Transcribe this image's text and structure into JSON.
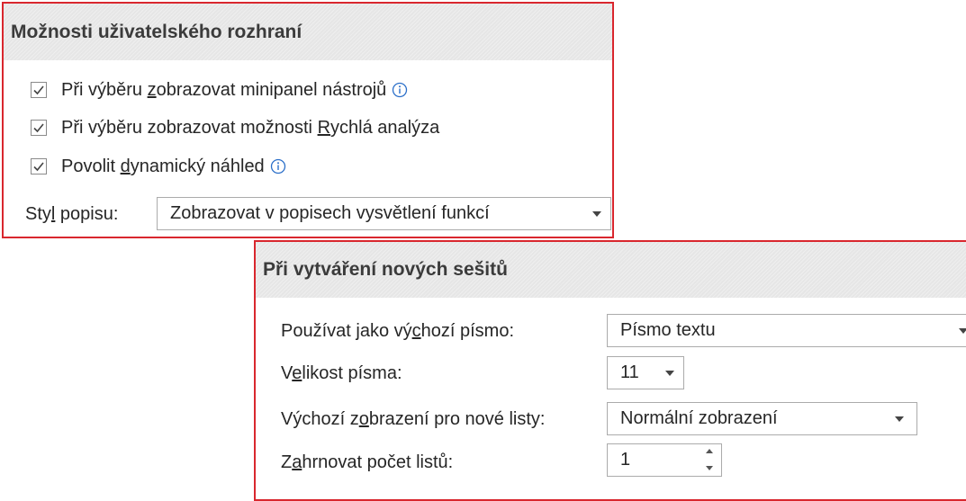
{
  "colors": {
    "highlight_border": "#d9272e",
    "header_bg": "#e6e6e6",
    "field_border": "#ababab"
  },
  "ui_options": {
    "title": "Možnosti uživatelského rozhraní",
    "checkboxes": [
      {
        "checked": true,
        "text_before": "Při výběru ",
        "underlined": "z",
        "text_after": "obrazovat minipanel nástrojů",
        "info_icon": "info-icon"
      },
      {
        "checked": true,
        "text_before": "Při výběru zobrazovat možnosti ",
        "underlined": "R",
        "text_after": "ychlá analýza"
      },
      {
        "checked": true,
        "text_before": "Povolit ",
        "underlined": "d",
        "text_after": "ynamický náhled",
        "info_icon": "info-icon"
      }
    ],
    "tooltip_style": {
      "label_before": "Sty",
      "label_underlined": "l",
      "label_after": " popisu:",
      "value": "Zobrazovat v popisech vysvětlení funkcí"
    }
  },
  "new_workbooks": {
    "title": "Při vytváření nových sešitů",
    "default_font": {
      "label_before": "Používat jako vý",
      "label_underlined": "c",
      "label_after": "hozí písmo:",
      "value": "Písmo textu"
    },
    "font_size": {
      "label_before": "V",
      "label_underlined": "e",
      "label_after": "likost písma:",
      "value": "11"
    },
    "default_view": {
      "label_before": "Výchozí z",
      "label_underlined": "o",
      "label_after": "brazení pro nové listy:",
      "value": "Normální zobrazení"
    },
    "sheet_count": {
      "label_before": "Z",
      "label_underlined": "a",
      "label_after": "hrnovat počet listů:",
      "value": "1"
    }
  }
}
